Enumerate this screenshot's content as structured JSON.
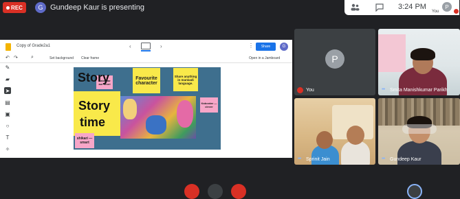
{
  "topbar": {
    "rec_label": "REC",
    "presenter_initial": "G",
    "presenting_text": "Gundeep Kaur is presenting",
    "time": "3:24 PM",
    "you_initial": "P",
    "you_label": "You"
  },
  "slides": {
    "title": "Copy of Grade2a1",
    "share_label": "Share",
    "avatar_initial": "G",
    "set_background": "Set background",
    "clear_frame": "Clear frame",
    "open_jamboard": "Open in a Jamboard",
    "canvas": {
      "note_kabootar_left": "Kabootar aur chori",
      "note_favourite": "Favourite character",
      "note_share": "Share anything in marwadi language.",
      "note_kabootar_right": "Kabootar — clever",
      "story_line1": "Story",
      "story_line2": "time",
      "note_shikari": "shikari — smart"
    }
  },
  "participants": [
    {
      "name": "You",
      "initial": "P",
      "muted": true
    },
    {
      "name": "Smita Manishkumar Parikh",
      "muted": false
    },
    {
      "name": "Sprinit Jain",
      "muted": false
    },
    {
      "name": "Gundeep Kaur",
      "muted": false
    }
  ],
  "colors": {
    "rec": "#d93025",
    "accent": "#1a73e8",
    "sticky_pink": "#f7a6c8",
    "sticky_yellow": "#f9e94a",
    "canvas_bg": "#3e6f8e"
  }
}
